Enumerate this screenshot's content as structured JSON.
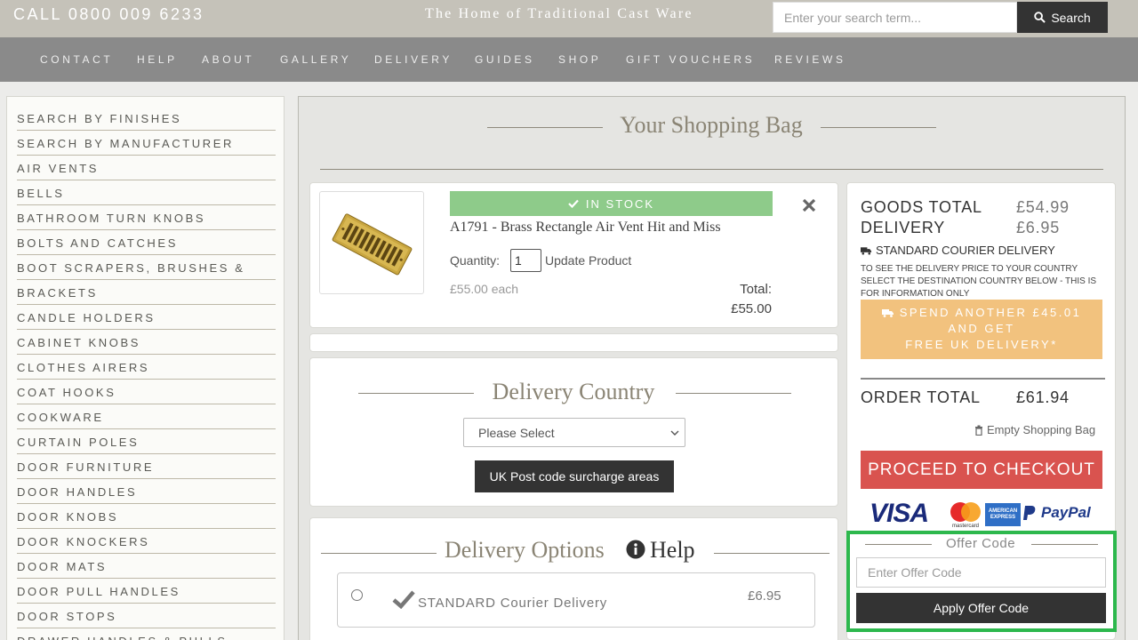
{
  "header": {
    "phone": "CALL 0800 009 6233",
    "tagline": "The Home of Traditional Cast Ware",
    "search_placeholder": "Enter your search term...",
    "search_button": "Search"
  },
  "nav": [
    "CONTACT",
    "HELP",
    "ABOUT",
    "GALLERY",
    "DELIVERY",
    "GUIDES",
    "SHOP",
    "GIFT VOUCHERS",
    "REVIEWS"
  ],
  "sidebar": {
    "categories": [
      "SEARCH BY FINISHES",
      "SEARCH BY MANUFACTURER",
      "AIR VENTS",
      "BELLS",
      "BATHROOM TURN KNOBS",
      "BOLTS AND CATCHES",
      "BOOT SCRAPERS, BRUSHES &",
      "BRACKETS",
      "CANDLE HOLDERS",
      "CABINET KNOBS",
      "CLOTHES AIRERS",
      "COAT HOOKS",
      "COOKWARE",
      "CURTAIN POLES",
      "DOOR FURNITURE",
      "DOOR HANDLES",
      "DOOR KNOBS",
      "DOOR KNOCKERS",
      "DOOR MATS",
      "DOOR PULL HANDLES",
      "DOOR STOPS",
      "DRAWER HANDLES & PULLS"
    ]
  },
  "bag": {
    "title": "Your Shopping Bag",
    "item": {
      "stock": "IN STOCK",
      "name": "A1791 - Brass Rectangle Air Vent Hit and Miss",
      "quantity_label": "Quantity:",
      "quantity": "1",
      "update_label": "Update Product",
      "price_each": "£55.00 each",
      "total_label": "Total:",
      "total": "£55.00"
    }
  },
  "delivery_country": {
    "title": "Delivery Country",
    "select_value": "Please Select",
    "surcharge_button": "UK Post code surcharge areas"
  },
  "delivery_options": {
    "title": "Delivery Options",
    "help": "Help",
    "options": [
      {
        "label": "STANDARD Courier Delivery",
        "price": "£6.95"
      }
    ]
  },
  "summary": {
    "goods_total_label": "GOODS TOTAL",
    "goods_total": "£54.99",
    "delivery_label": "DELIVERY",
    "delivery": "£6.95",
    "courier": "STANDARD COURIER DELIVERY",
    "note": "TO SEE THE DELIVERY PRICE TO YOUR COUNTRY SELECT THE DESTINATION COUNTRY BELOW - THIS IS FOR INFORMATION ONLY",
    "promo_line1": "SPEND ANOTHER £45.01",
    "promo_line2": "AND GET",
    "promo_line3": "FREE UK DELIVERY*",
    "order_total_label": "ORDER TOTAL",
    "order_total": "£61.94",
    "empty_bag": "Empty Shopping Bag",
    "checkout": "PROCEED TO CHECKOUT",
    "payments": {
      "visa": "VISA",
      "mastercard": "mastercard",
      "amex": "AMERICAN EXPRESS",
      "paypal": "PayPal"
    },
    "offer_title": "Offer Code",
    "offer_placeholder": "Enter Offer Code",
    "offer_button": "Apply Offer Code"
  },
  "colors": {
    "topbar": "#c5c2b9",
    "nav": "#8a8a8a",
    "stock": "#8ecb8a",
    "promo": "#f2c27e",
    "checkout": "#d9534f",
    "highlight": "#2db84d"
  }
}
